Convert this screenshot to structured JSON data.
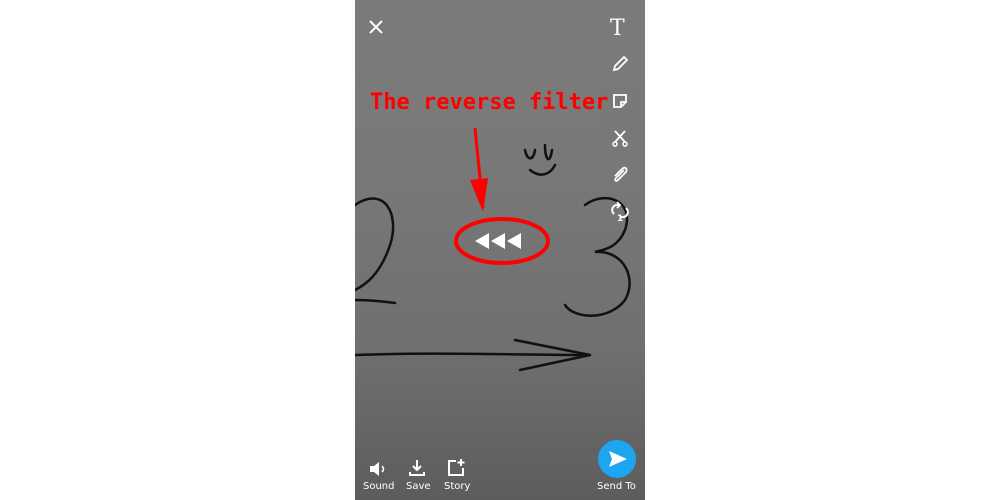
{
  "annotation": {
    "text": "The reverse filter",
    "color": "#ff0000"
  },
  "toolbar": {
    "items": [
      "text-tool",
      "pencil-tool",
      "sticker-tool",
      "scissors-tool",
      "attachment-tool",
      "loop-tool"
    ],
    "loop_badge": "1"
  },
  "bottom": {
    "sound": "Sound",
    "save": "Save",
    "story": "Story",
    "send": "Send To"
  },
  "colors": {
    "send_button": "#1ea5f0"
  }
}
